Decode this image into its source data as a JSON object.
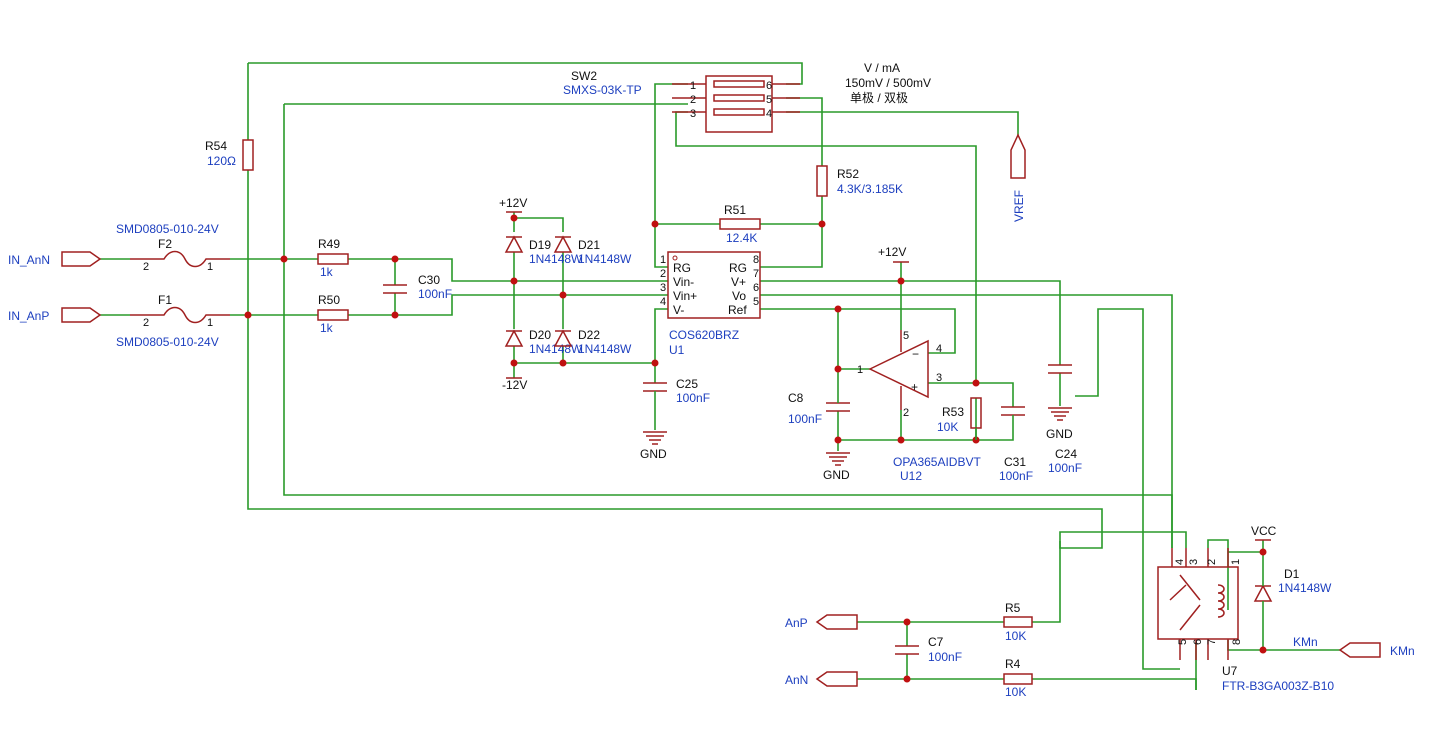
{
  "title": {
    "line1": "V / mA",
    "line2": "150mV / 500mV",
    "line3": "单极 / 双极"
  },
  "ports": {
    "in_ann": "IN_AnN",
    "in_anp": "IN_AnP",
    "vref": "VREF",
    "anp": "AnP",
    "ann": "AnN",
    "kmn_port": "KMn",
    "kmn_net": "KMn"
  },
  "power": {
    "p12_top": "+12V",
    "m12": "-12V",
    "p12_opa": "+12V",
    "vcc": "VCC",
    "gnd_c25": "GND",
    "gnd_c8": "GND",
    "gnd_c24": "GND"
  },
  "components": {
    "f2": {
      "ref": "F2",
      "value": "SMD0805-010-24V",
      "pin_a": "2",
      "pin_b": "1"
    },
    "f1": {
      "ref": "F1",
      "value": "SMD0805-010-24V",
      "pin_a": "2",
      "pin_b": "1"
    },
    "r54": {
      "ref": "R54",
      "value": "120Ω"
    },
    "r49": {
      "ref": "R49",
      "value": "1k"
    },
    "r50": {
      "ref": "R50",
      "value": "1k"
    },
    "c30": {
      "ref": "C30",
      "value": "100nF"
    },
    "d19": {
      "ref": "D19",
      "value": "1N4148W"
    },
    "d21": {
      "ref": "D21",
      "value": "1N4148W"
    },
    "d20": {
      "ref": "D20",
      "value": "1N4148W"
    },
    "d22": {
      "ref": "D22",
      "value": "1N4148W"
    },
    "sw2": {
      "ref": "SW2",
      "value": "SMXS-03K-TP",
      "pins": [
        "1",
        "2",
        "3",
        "6",
        "5",
        "4"
      ]
    },
    "r52": {
      "ref": "R52",
      "value": "4.3K/3.185K"
    },
    "r51": {
      "ref": "R51",
      "value": "12.4K"
    },
    "u1": {
      "ref": "U1",
      "value": "COS620BRZ",
      "left_pins": [
        {
          "num": "1",
          "name": "RG"
        },
        {
          "num": "2",
          "name": "Vin-"
        },
        {
          "num": "3",
          "name": "Vin+"
        },
        {
          "num": "4",
          "name": "V-"
        }
      ],
      "right_pins": [
        {
          "num": "8",
          "name": "RG"
        },
        {
          "num": "7",
          "name": "V+"
        },
        {
          "num": "6",
          "name": "Vo"
        },
        {
          "num": "5",
          "name": "Ref"
        }
      ]
    },
    "c25": {
      "ref": "C25",
      "value": "100nF"
    },
    "u12": {
      "ref": "U12",
      "value": "OPA365AIDBVT",
      "pins": [
        "1",
        "5",
        "4",
        "3",
        "2"
      ],
      "minus": "−",
      "plus": "+"
    },
    "c8": {
      "ref": "C8",
      "value": "100nF"
    },
    "r53": {
      "ref": "R53",
      "value": "10K"
    },
    "c31": {
      "ref": "C31",
      "value": "100nF"
    },
    "c24": {
      "ref": "C24",
      "value": "100nF"
    },
    "u7": {
      "ref": "U7",
      "value": "FTR-B3GA003Z-B10",
      "pins": [
        "4",
        "3",
        "2",
        "1",
        "5",
        "6",
        "7",
        "8"
      ]
    },
    "d1": {
      "ref": "D1",
      "value": "1N4148W"
    },
    "r5": {
      "ref": "R5",
      "value": "10K"
    },
    "r4": {
      "ref": "R4",
      "value": "10K"
    },
    "c7": {
      "ref": "C7",
      "value": "100nF"
    }
  },
  "colors": {
    "wire": "#2a9a2a",
    "symbol": "#a02020",
    "value_text": "#1d3fbf",
    "junction": "#c01010"
  }
}
